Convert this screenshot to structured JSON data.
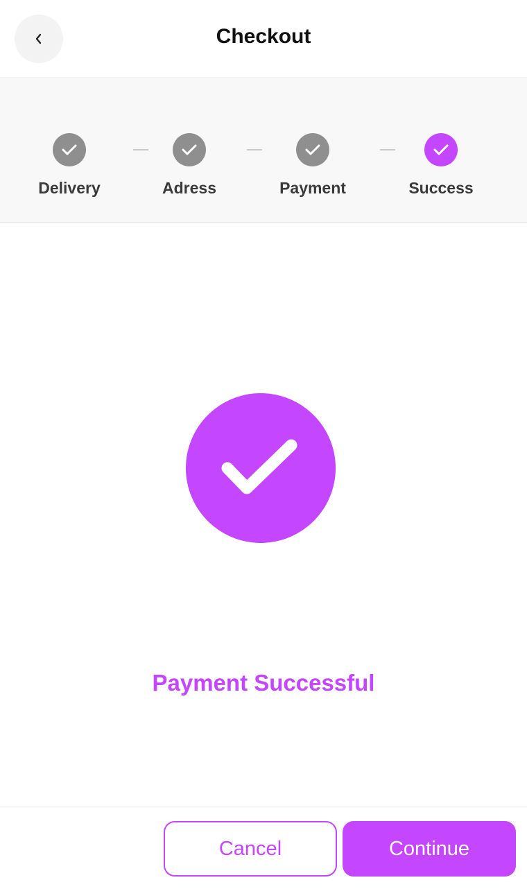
{
  "colors": {
    "accent": "#c446ff",
    "step_done": "#8f8f8f",
    "text_dark": "#111111",
    "label_text": "#3a3a3a",
    "stepper_bg": "#f8f8f8"
  },
  "header": {
    "title": "Checkout",
    "back_icon": "chevron-left-icon"
  },
  "stepper": {
    "steps": [
      {
        "label": "Delivery",
        "state": "completed",
        "icon": "check-icon"
      },
      {
        "label": "Adress",
        "state": "completed",
        "icon": "check-icon"
      },
      {
        "label": "Payment",
        "state": "completed",
        "icon": "check-icon"
      },
      {
        "label": "Success",
        "state": "active",
        "icon": "check-icon"
      }
    ]
  },
  "main": {
    "status_icon": "check-circle-icon",
    "message": "Payment Successful"
  },
  "footer": {
    "cancel_label": "Cancel",
    "continue_label": "Continue"
  }
}
